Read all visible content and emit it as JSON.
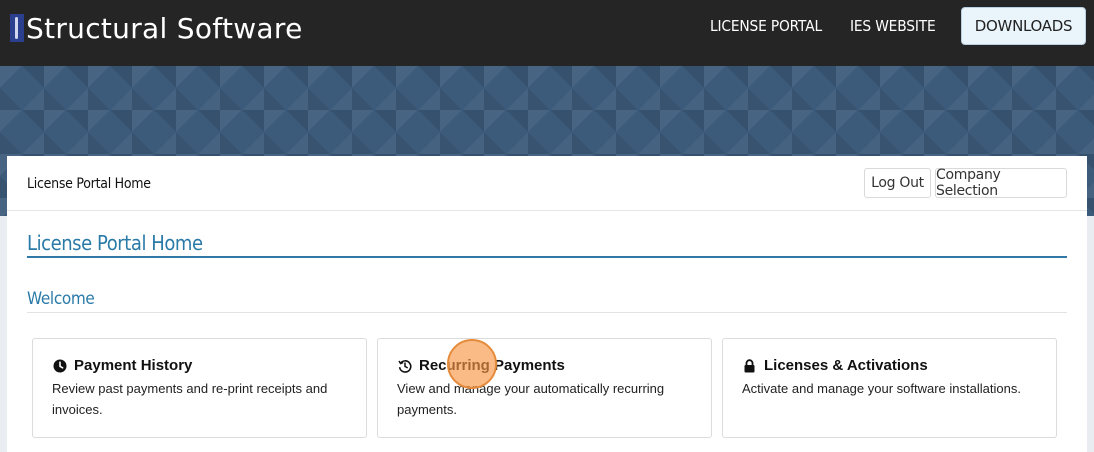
{
  "brand": {
    "name": "Structural Software"
  },
  "nav": {
    "license_portal": "LICENSE PORTAL",
    "ies_website": "IES WEBSITE",
    "downloads": "DOWNLOADS"
  },
  "panel": {
    "breadcrumb": "License Portal Home",
    "logout_label": "Log Out",
    "company_selection_label": "Company Selection",
    "page_title": "License Portal Home",
    "welcome": "Welcome"
  },
  "tiles": [
    {
      "icon": "clock-icon",
      "title": "Payment History",
      "description": "Review past payments and re-print receipts and invoices."
    },
    {
      "icon": "history-icon",
      "title": "Recurring Payments",
      "description": "View and manage your automatically recurring payments."
    },
    {
      "icon": "lock-icon",
      "title": "Licenses & Activations",
      "description": "Activate and manage your software installations."
    }
  ],
  "colors": {
    "topbar": "#252525",
    "accent": "#2a7aa8",
    "banner": "#3c5a7a",
    "click_indicator": "#f79646"
  }
}
